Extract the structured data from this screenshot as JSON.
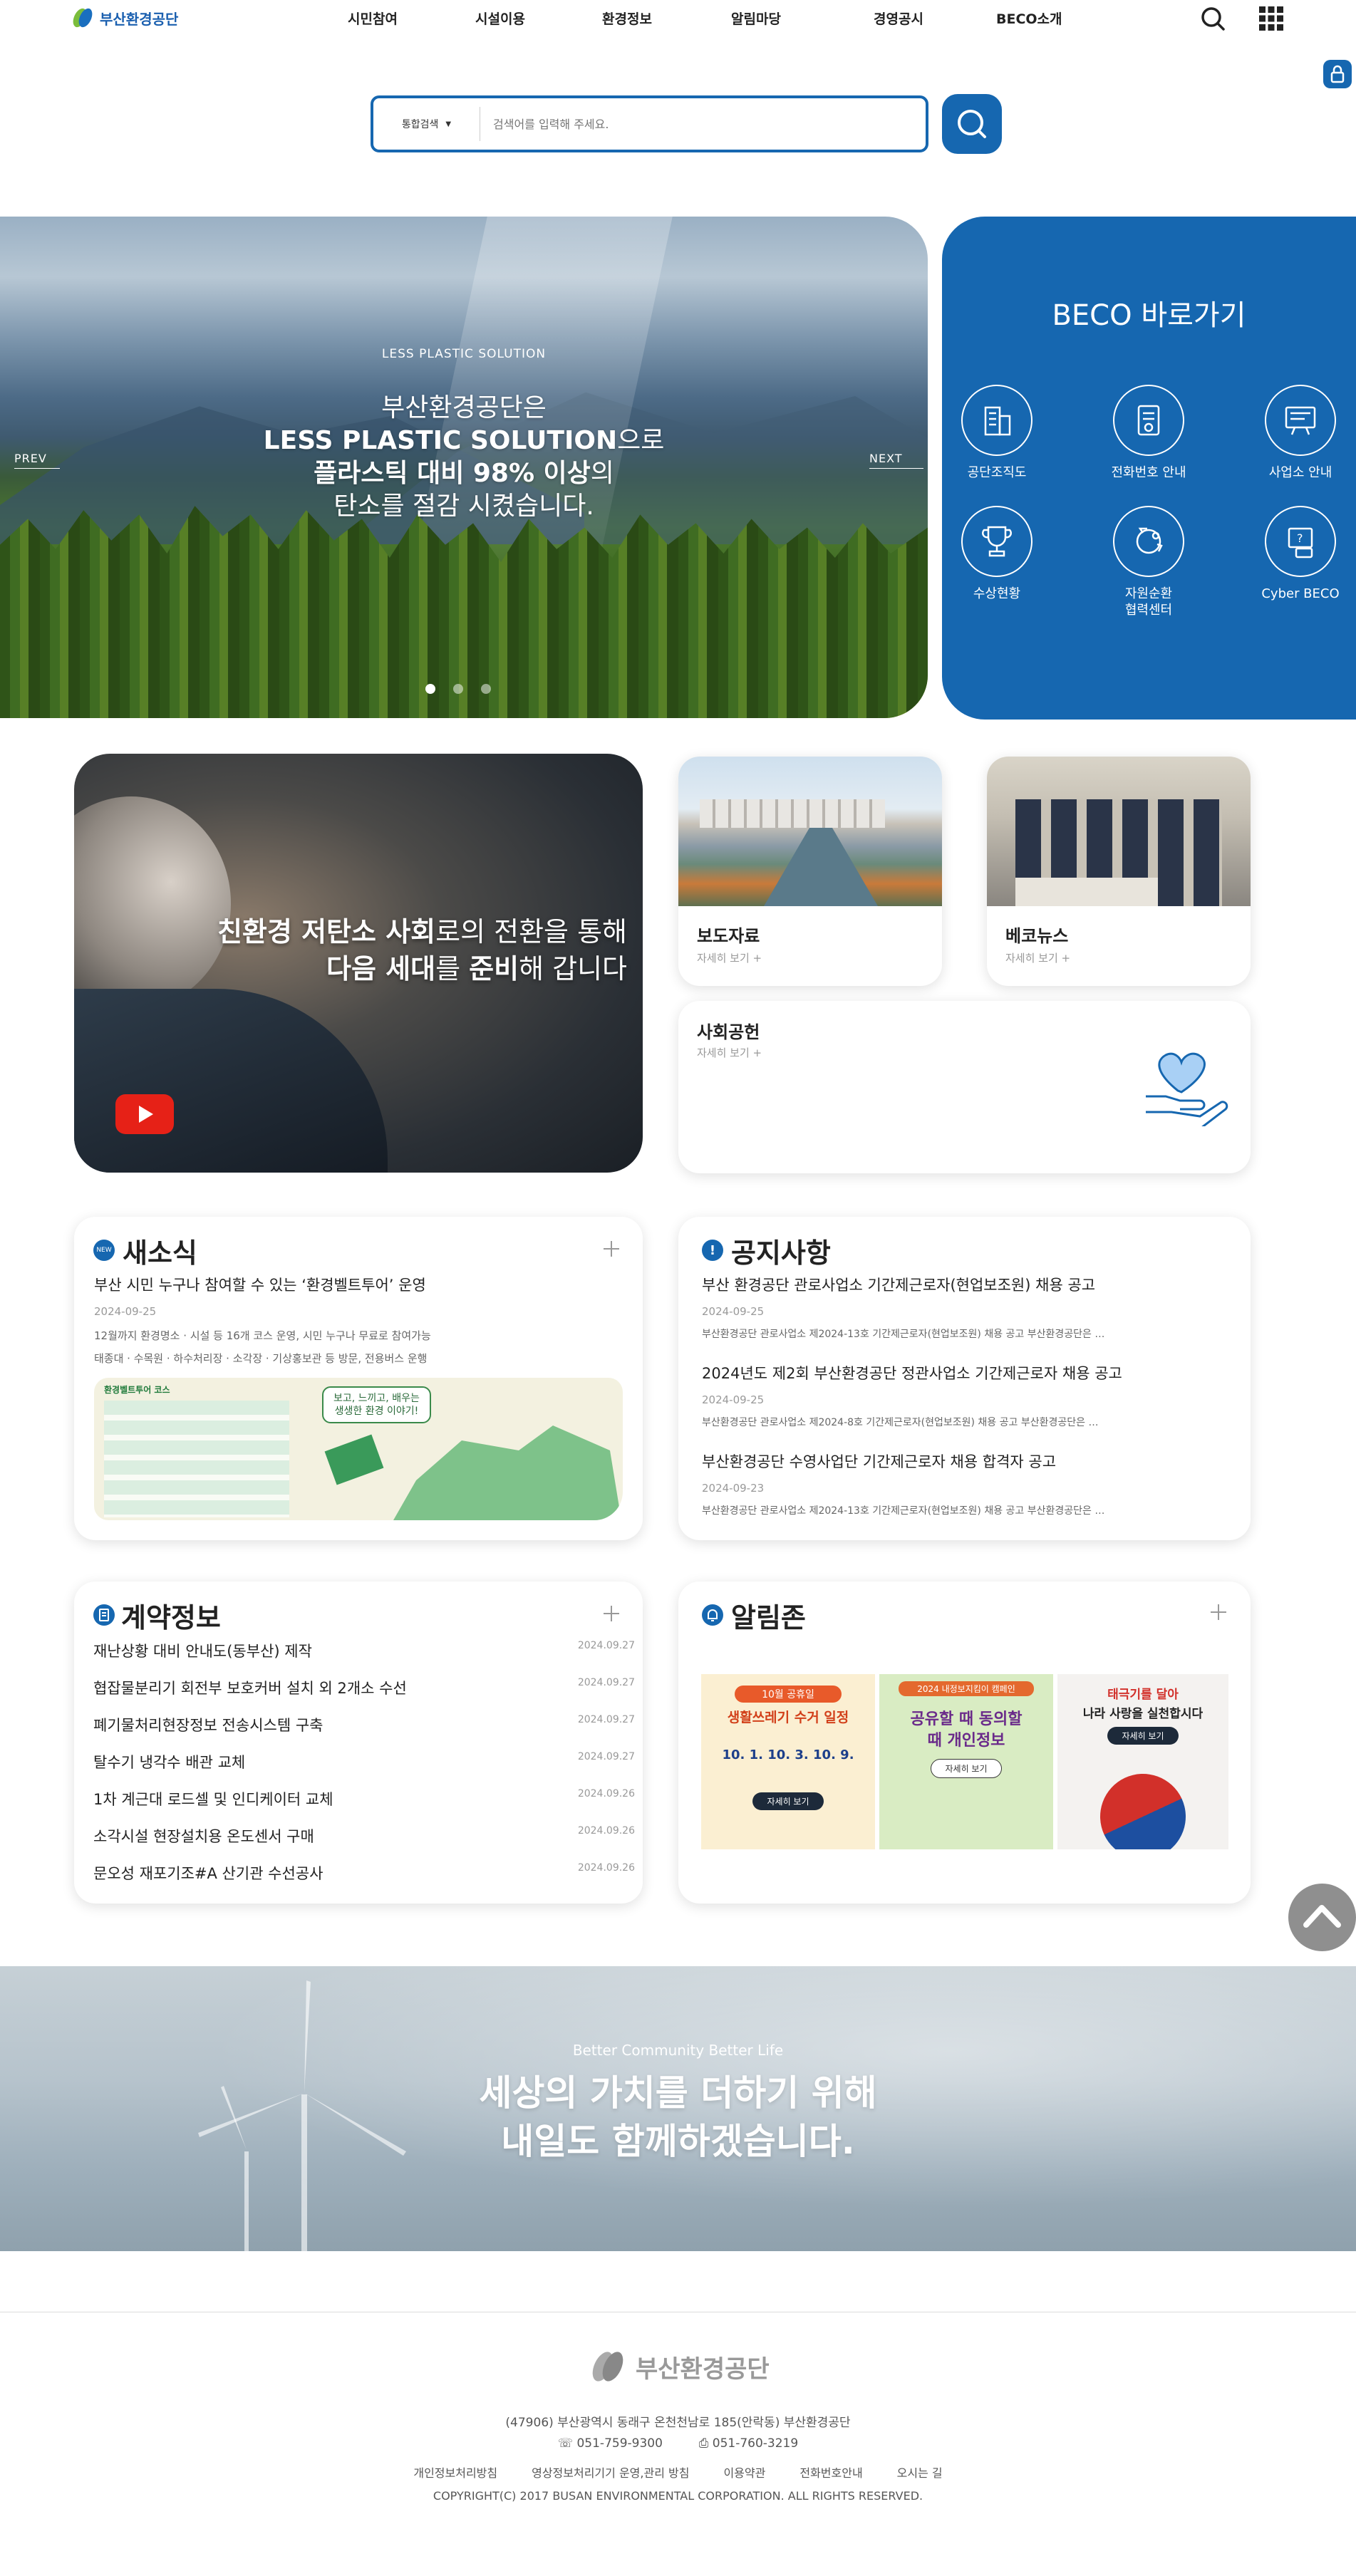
{
  "header": {
    "logo_text": "부산환경공단",
    "nav": [
      "시민참여",
      "시설이용",
      "환경정보",
      "알림마당",
      "경영공시",
      "BECO소개"
    ]
  },
  "search": {
    "category": "통합검색",
    "placeholder": "검색어를 입력해 주세요."
  },
  "hero": {
    "subtitle": "LESS PLASTIC SOLUTION",
    "line1": "부산환경공단은",
    "line2_bold": "LESS PLASTIC SOLUTION",
    "line2_rest": "으로",
    "line3_bold": "플라스틱 대비 98% 이상",
    "line3_rest": "의",
    "line4": "탄소를 절감 시켰습니다.",
    "prev": "PREV",
    "next": "NEXT",
    "slide_count": 3,
    "active_slide": 1
  },
  "beco": {
    "title": "BECO 바로가기",
    "items": [
      {
        "label": "공단조직도",
        "icon": "building-icon"
      },
      {
        "label": "전화번호 안내",
        "icon": "phone-book-icon"
      },
      {
        "label": "사업소 안내",
        "icon": "map-board-icon"
      },
      {
        "label": "수상현황",
        "icon": "trophy-icon"
      },
      {
        "label": "자원순환\n협력센터",
        "icon": "recycle-icon"
      },
      {
        "label": "Cyber BECO",
        "icon": "cyber-icon"
      }
    ]
  },
  "video": {
    "line1_bold": "친환경 저탄소 사회",
    "line1_rest": "로의 전환을 통해",
    "line2_a": "다음 세대",
    "line2_b": "를 ",
    "line2_c": "준비",
    "line2_d": "해 갑니다"
  },
  "promo": {
    "press": {
      "title": "보도자료",
      "more": "자세히 보기 +"
    },
    "news": {
      "title": "베코뉴스",
      "more": "자세히 보기 +"
    },
    "social": {
      "title": "사회공헌",
      "more": "자세히 보기 +"
    }
  },
  "news_board": {
    "title": "새소식",
    "badge": "NEW",
    "item_title": "부산 시민 누구나 참여할 수 있는 ‘환경벨트투어’ 운영",
    "item_date": "2024-09-25",
    "desc1": "12월까지 환경명소 · 시설 등 16개 코스 운영, 시민 누구나 무료로 참여가능",
    "desc2": "태종대 · 수목원 · 하수처리장 · 소각장 · 기상홍보관 등 방문, 전용버스 운행",
    "img_caption1": "환경벨트투어 코스",
    "img_caption2": "보고, 느끼고, 배우는",
    "img_caption3": "생생한 환경 이야기!"
  },
  "notice_board": {
    "title": "공지사항",
    "items": [
      {
        "title": "부산 환경공단 관로사업소 기간제근로자(현업보조원) 채용 공고",
        "date": "2024-09-25",
        "desc": "부산환경공단 관로사업소 제2024-13호 기간제근로자(현업보조원) 채용 공고 부산환경공단은 …"
      },
      {
        "title": "2024년도 제2회 부산환경공단 정관사업소 기간제근로자 채용 공고",
        "date": "2024-09-25",
        "desc": "부산환경공단 관로사업소 제2024-8호 기간제근로자(현업보조원) 채용 공고 부산환경공단은 …"
      },
      {
        "title": "부산환경공단 수영사업단 기간제근로자 채용 합격자 공고",
        "date": "2024-09-23",
        "desc": "부산환경공단 관로사업소 제2024-13호 기간제근로자(현업보조원) 채용 공고 부산환경공단은 …"
      }
    ]
  },
  "contract_board": {
    "title": "계약정보",
    "items": [
      {
        "title": "재난상황 대비 안내도(동부산) 제작",
        "date": "2024.09.27"
      },
      {
        "title": "협잡물분리기 회전부 보호커버 설치 외 2개소 수선",
        "date": "2024.09.27"
      },
      {
        "title": "폐기물처리현장정보 전송시스템 구축",
        "date": "2024.09.27"
      },
      {
        "title": "탈수기 냉각수 배관 교체",
        "date": "2024.09.27"
      },
      {
        "title": "1차 계근대 로드셀 및 인디케이터 교체",
        "date": "2024.09.26"
      },
      {
        "title": "소각시설 현장설치용 온도센서 구매",
        "date": "2024.09.26"
      },
      {
        "title": "문오성 재포기조#A 산기관 수선공사",
        "date": "2024.09.26"
      }
    ]
  },
  "alert_board": {
    "title": "알림존",
    "cards": [
      {
        "head": "10월 공휴일",
        "title": "생활쓰레기 수거 일정",
        "dates": "10. 1.   10. 3.   10. 9.",
        "btn": "자세히 보기"
      },
      {
        "head": "2024 내정보지킴이 캠페인",
        "title": "공유할 때 동의할 때 개인정보",
        "btn": "자세히 보기"
      },
      {
        "head": "태극기를 달아",
        "title": "나라 사랑을 실천합시다",
        "btn": "자세히 보기"
      }
    ]
  },
  "strip": {
    "sub": "Better Community Better Life",
    "line1": "세상의 가치를 더하기 위해",
    "line2": "내일도 함께하겠습니다."
  },
  "footer": {
    "logo_text": "부산환경공단",
    "address": "(47906) 부산광역시 동래구 온천천남로 185(안락동) 부산환경공단",
    "tel": "051-759-9300",
    "fax": "051-760-3219",
    "links": [
      "개인정보처리방침",
      "영상정보처리기기 운영,관리 방침",
      "이용약관",
      "전화번호안내",
      "오시는 길"
    ],
    "copyright": "COPYRIGHT(C) 2017 BUSAN ENVIRONMENTAL CORPORATION. ALL RIGHTS RESERVED."
  },
  "colors": {
    "brand": "#1667b0",
    "text": "#222222",
    "muted": "#999999"
  }
}
